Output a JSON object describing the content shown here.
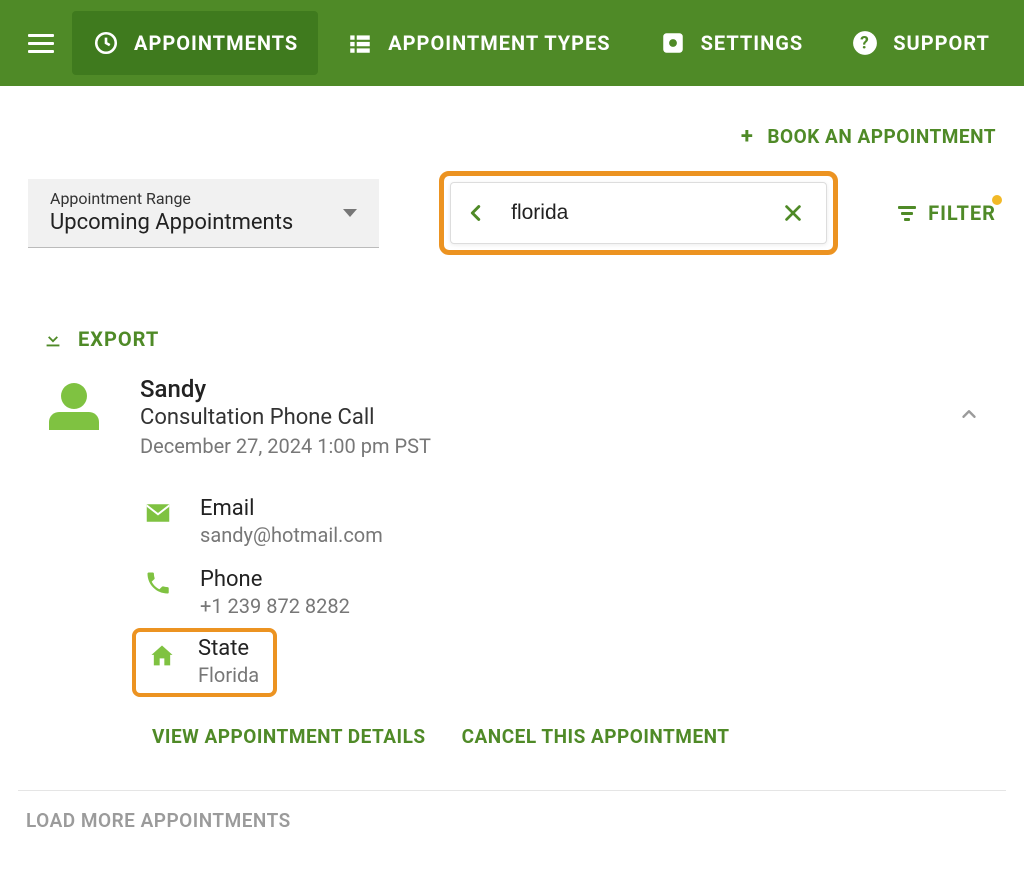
{
  "nav": {
    "items": [
      {
        "label": "APPOINTMENTS",
        "active": true
      },
      {
        "label": "APPOINTMENT TYPES",
        "active": false
      },
      {
        "label": "SETTINGS",
        "active": false
      },
      {
        "label": "SUPPORT",
        "active": false
      }
    ]
  },
  "actions": {
    "book_label": "BOOK AN APPOINTMENT",
    "export_label": "EXPORT",
    "filter_label": "FILTER",
    "load_more_label": "LOAD MORE APPOINTMENTS"
  },
  "range": {
    "label": "Appointment Range",
    "value": "Upcoming Appointments"
  },
  "search": {
    "value": "florida"
  },
  "appointment": {
    "name": "Sandy",
    "type": "Consultation Phone Call",
    "datetime": "December 27, 2024 1:00 pm PST",
    "details": {
      "email_label": "Email",
      "email_value": "sandy@hotmail.com",
      "phone_label": "Phone",
      "phone_value": "+1 239 872 8282",
      "state_label": "State",
      "state_value": "Florida"
    },
    "view_label": "VIEW APPOINTMENT DETAILS",
    "cancel_label": "CANCEL THIS APPOINTMENT"
  },
  "colors": {
    "primary": "#4f8a27",
    "accent": "#7fc241",
    "highlight": "#ec9321",
    "badge": "#f2b927"
  }
}
